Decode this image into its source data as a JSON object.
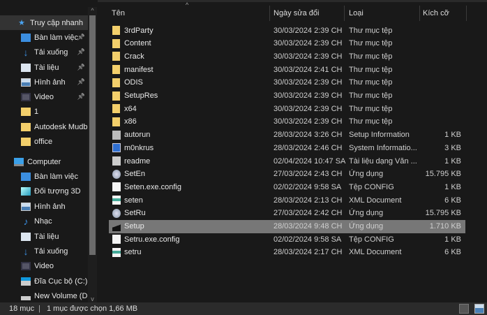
{
  "sidebar": {
    "items": [
      {
        "label": "Truy cập nhanh",
        "icon": "star-icon",
        "selected": true,
        "pinned": false,
        "indent": false
      },
      {
        "label": "Bàn làm việc",
        "icon": "desktop-icon",
        "pinned": true,
        "indent": true
      },
      {
        "label": "Tải xuống",
        "icon": "download-icon",
        "pinned": true,
        "indent": true
      },
      {
        "label": "Tài liệu",
        "icon": "document-icon",
        "pinned": true,
        "indent": true
      },
      {
        "label": "Hình ảnh",
        "icon": "pictures-icon",
        "pinned": true,
        "indent": true
      },
      {
        "label": "Video",
        "icon": "video-icon",
        "pinned": true,
        "indent": true
      },
      {
        "label": "1",
        "icon": "folder-icon",
        "pinned": false,
        "indent": true
      },
      {
        "label": "Autodesk Mudb",
        "icon": "folder-icon",
        "pinned": false,
        "indent": true
      },
      {
        "label": "office",
        "icon": "folder-icon",
        "pinned": false,
        "indent": true
      },
      {
        "label": "Computer",
        "icon": "computer-icon",
        "pinned": false,
        "indent": false
      },
      {
        "label": "Bàn làm việc",
        "icon": "desktop-icon",
        "pinned": false,
        "indent": true
      },
      {
        "label": "Đối tượng 3D",
        "icon": "3d-objects-icon",
        "pinned": false,
        "indent": true
      },
      {
        "label": "Hình ảnh",
        "icon": "pictures-icon",
        "pinned": false,
        "indent": true
      },
      {
        "label": "Nhạc",
        "icon": "music-icon",
        "pinned": false,
        "indent": true
      },
      {
        "label": "Tài liệu",
        "icon": "document-icon",
        "pinned": false,
        "indent": true
      },
      {
        "label": "Tải xuống",
        "icon": "download-icon",
        "pinned": false,
        "indent": true
      },
      {
        "label": "Video",
        "icon": "video-icon",
        "pinned": false,
        "indent": true
      },
      {
        "label": "Đĩa Cục bộ (C:)",
        "icon": "local-disk-icon",
        "pinned": false,
        "indent": true
      },
      {
        "label": "New Volume (D:)",
        "icon": "drive-icon",
        "pinned": false,
        "indent": true
      }
    ]
  },
  "columns": {
    "name": "Tên",
    "date": "Ngày sửa đổi",
    "type": "Loại",
    "size": "Kích cỡ"
  },
  "files": [
    {
      "name": "3rdParty",
      "date": "30/03/2024 2:39 CH",
      "type": "Thư mục tệp",
      "size": "",
      "icon": "folder-icon"
    },
    {
      "name": "Content",
      "date": "30/03/2024 2:39 CH",
      "type": "Thư mục tệp",
      "size": "",
      "icon": "folder-icon"
    },
    {
      "name": "Crack",
      "date": "30/03/2024 2:39 CH",
      "type": "Thư mục tệp",
      "size": "",
      "icon": "folder-icon"
    },
    {
      "name": "manifest",
      "date": "30/03/2024 2:41 CH",
      "type": "Thư mục tệp",
      "size": "",
      "icon": "folder-icon"
    },
    {
      "name": "ODIS",
      "date": "30/03/2024 2:39 CH",
      "type": "Thư mục tệp",
      "size": "",
      "icon": "folder-icon"
    },
    {
      "name": "SetupRes",
      "date": "30/03/2024 2:39 CH",
      "type": "Thư mục tệp",
      "size": "",
      "icon": "folder-icon"
    },
    {
      "name": "x64",
      "date": "30/03/2024 2:39 CH",
      "type": "Thư mục tệp",
      "size": "",
      "icon": "folder-icon"
    },
    {
      "name": "x86",
      "date": "30/03/2024 2:39 CH",
      "type": "Thư mục tệp",
      "size": "",
      "icon": "folder-icon"
    },
    {
      "name": "autorun",
      "date": "28/03/2024 3:26 CH",
      "type": "Setup Information",
      "size": "1 KB",
      "icon": "setup-info-icon"
    },
    {
      "name": "m0nkrus",
      "date": "28/03/2024 2:46 CH",
      "type": "System Informatio...",
      "size": "3 KB",
      "icon": "system-info-icon"
    },
    {
      "name": "readme",
      "date": "02/04/2024 10:47 SA",
      "type": "Tài liệu dạng Văn ...",
      "size": "1 KB",
      "icon": "text-file-icon"
    },
    {
      "name": "SetEn",
      "date": "27/03/2024 2:43 CH",
      "type": "Ứng dụng",
      "size": "15.795 KB",
      "icon": "app-icon"
    },
    {
      "name": "Seten.exe.config",
      "date": "02/02/2024 9:58 SA",
      "type": "Tệp CONFIG",
      "size": "1 KB",
      "icon": "file-icon"
    },
    {
      "name": "seten",
      "date": "28/03/2024 2:13 CH",
      "type": "XML Document",
      "size": "6 KB",
      "icon": "xml-icon"
    },
    {
      "name": "SetRu",
      "date": "27/03/2024 2:42 CH",
      "type": "Ứng dụng",
      "size": "15.795 KB",
      "icon": "app-icon"
    },
    {
      "name": "Setup",
      "date": "28/03/2024 9:48 CH",
      "type": "Ứng dụng",
      "size": "1.710 KB",
      "icon": "autodesk-icon",
      "selected": true
    },
    {
      "name": "Setru.exe.config",
      "date": "02/02/2024 9:58 SA",
      "type": "Tệp CONFIG",
      "size": "1 KB",
      "icon": "file-icon"
    },
    {
      "name": "setru",
      "date": "28/03/2024 2:17 CH",
      "type": "XML Document",
      "size": "6 KB",
      "icon": "xml-icon"
    }
  ],
  "status": {
    "count": "18 mục",
    "sep": "|",
    "selected": "1 mục được chọn  1,66 MB"
  }
}
